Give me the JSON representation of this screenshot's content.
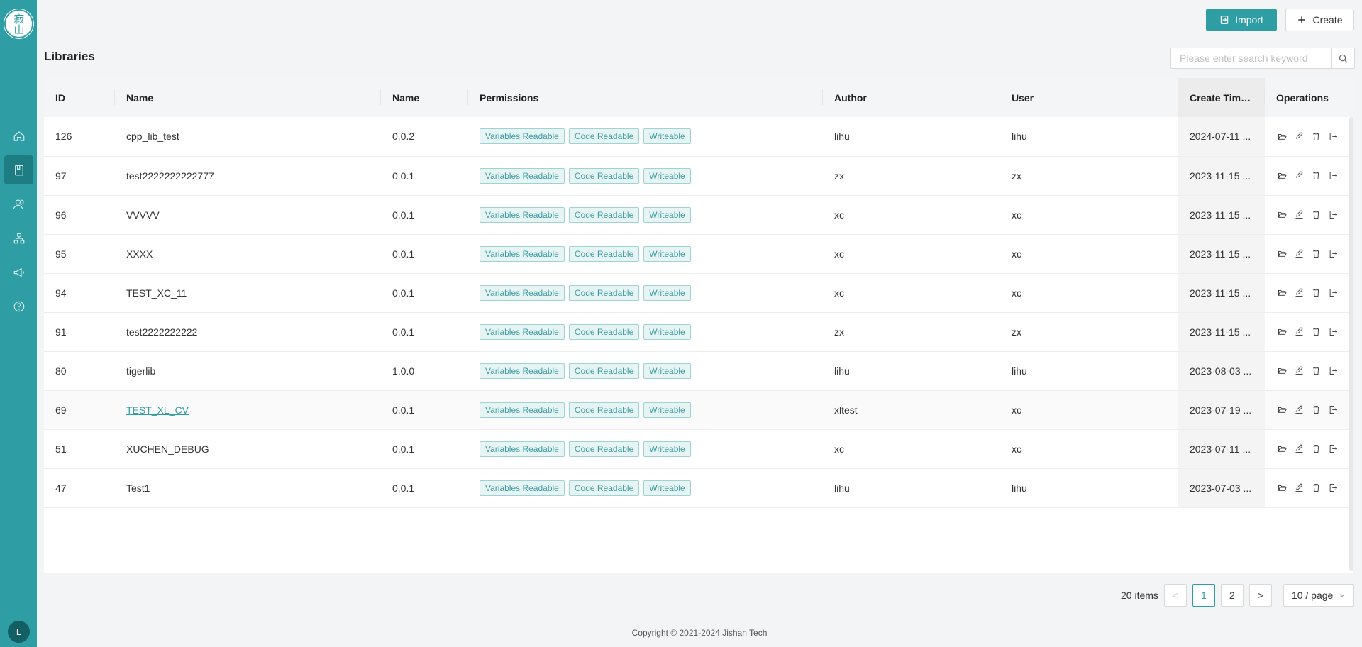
{
  "app": {
    "logo_text": "寂山",
    "avatar_initial": "L"
  },
  "sidebar": {
    "items": [
      {
        "icon": "home-icon"
      },
      {
        "icon": "book-icon",
        "active": true
      },
      {
        "icon": "users-icon"
      },
      {
        "icon": "hierarchy-icon"
      },
      {
        "icon": "megaphone-icon"
      },
      {
        "icon": "help-icon"
      }
    ]
  },
  "toolbar": {
    "import_label": "Import",
    "create_label": "Create"
  },
  "page": {
    "title": "Libraries"
  },
  "search": {
    "placeholder": "Please enter search keyword",
    "value": ""
  },
  "table": {
    "columns": [
      "ID",
      "Name",
      "Name",
      "Permissions",
      "Author",
      "User",
      "Create Time",
      "Operations"
    ],
    "sorted_column": "Create Time",
    "rows": [
      {
        "id": "126",
        "name": "cpp_lib_test",
        "version": "0.0.2",
        "permissions": [
          "Variables Readable",
          "Code Readable",
          "Writeable"
        ],
        "author": "lihu",
        "user": "lihu",
        "create_time": "2024-07-11 ..."
      },
      {
        "id": "97",
        "name": "test2222222222777",
        "version": "0.0.1",
        "permissions": [
          "Variables Readable",
          "Code Readable",
          "Writeable"
        ],
        "author": "zx",
        "user": "zx",
        "create_time": "2023-11-15 ..."
      },
      {
        "id": "96",
        "name": "VVVVV",
        "version": "0.0.1",
        "permissions": [
          "Variables Readable",
          "Code Readable",
          "Writeable"
        ],
        "author": "xc",
        "user": "xc",
        "create_time": "2023-11-15 ..."
      },
      {
        "id": "95",
        "name": "XXXX",
        "version": "0.0.1",
        "permissions": [
          "Variables Readable",
          "Code Readable",
          "Writeable"
        ],
        "author": "xc",
        "user": "xc",
        "create_time": "2023-11-15 ..."
      },
      {
        "id": "94",
        "name": "TEST_XC_11",
        "version": "0.0.1",
        "permissions": [
          "Variables Readable",
          "Code Readable",
          "Writeable"
        ],
        "author": "xc",
        "user": "xc",
        "create_time": "2023-11-15 ..."
      },
      {
        "id": "91",
        "name": "test2222222222",
        "version": "0.0.1",
        "permissions": [
          "Variables Readable",
          "Code Readable",
          "Writeable"
        ],
        "author": "zx",
        "user": "zx",
        "create_time": "2023-11-15 ..."
      },
      {
        "id": "80",
        "name": "tigerlib",
        "version": "1.0.0",
        "permissions": [
          "Variables Readable",
          "Code Readable",
          "Writeable"
        ],
        "author": "lihu",
        "user": "lihu",
        "create_time": "2023-08-03 ..."
      },
      {
        "id": "69",
        "name": "TEST_XL_CV",
        "version": "0.0.1",
        "permissions": [
          "Variables Readable",
          "Code Readable",
          "Writeable"
        ],
        "author": "xltest",
        "user": "xc",
        "create_time": "2023-07-19 ...",
        "link": true,
        "hover": true
      },
      {
        "id": "51",
        "name": "XUCHEN_DEBUG",
        "version": "0.0.1",
        "permissions": [
          "Variables Readable",
          "Code Readable",
          "Writeable"
        ],
        "author": "xc",
        "user": "xc",
        "create_time": "2023-07-11 ..."
      },
      {
        "id": "47",
        "name": "Test1",
        "version": "0.0.1",
        "permissions": [
          "Variables Readable",
          "Code Readable",
          "Writeable"
        ],
        "author": "lihu",
        "user": "lihu",
        "create_time": "2023-07-03 ..."
      }
    ],
    "row_operations": [
      "folder-open-icon",
      "edit-icon",
      "delete-icon",
      "export-icon"
    ]
  },
  "pagination": {
    "total_label": "20 items",
    "prev": "<",
    "pages": [
      "1",
      "2"
    ],
    "current_page": "1",
    "next": ">",
    "page_size_label": "10 / page"
  },
  "footer": {
    "copyright": "Copyright © 2021-2024 Jishan Tech"
  },
  "colors": {
    "accent": "#2e9ea4",
    "sidebar_bg": "#2e9ea4"
  }
}
